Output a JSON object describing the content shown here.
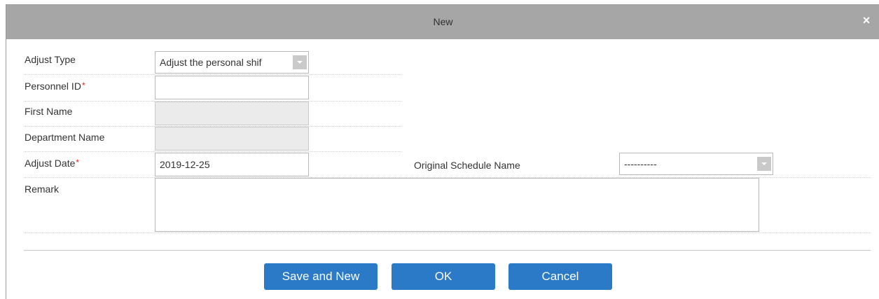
{
  "dialog": {
    "title": "New",
    "close_glyph": "×",
    "close_icon": "close-icon",
    "title_bar_color": "#a6a6a6"
  },
  "form": {
    "adjust_type": {
      "label": "Adjust Type",
      "value": "Adjust the personal shif"
    },
    "personnel_id": {
      "label": "Personnel ID",
      "required_mark": "*",
      "value": ""
    },
    "first_name": {
      "label": "First Name",
      "value": ""
    },
    "department_name": {
      "label": "Department Name",
      "value": ""
    },
    "adjust_date": {
      "label": "Adjust Date",
      "required_mark": "*",
      "value": "2019-12-25"
    },
    "original_schedule_name": {
      "label": "Original Schedule Name",
      "value": "----------"
    },
    "remark": {
      "label": "Remark",
      "value": ""
    }
  },
  "buttons": {
    "save_and_new": "Save and New",
    "ok": "OK",
    "cancel": "Cancel",
    "color": "#2a7ac8"
  },
  "colors": {
    "required": "#e2231a",
    "disabled_field": "#ebebeb"
  }
}
